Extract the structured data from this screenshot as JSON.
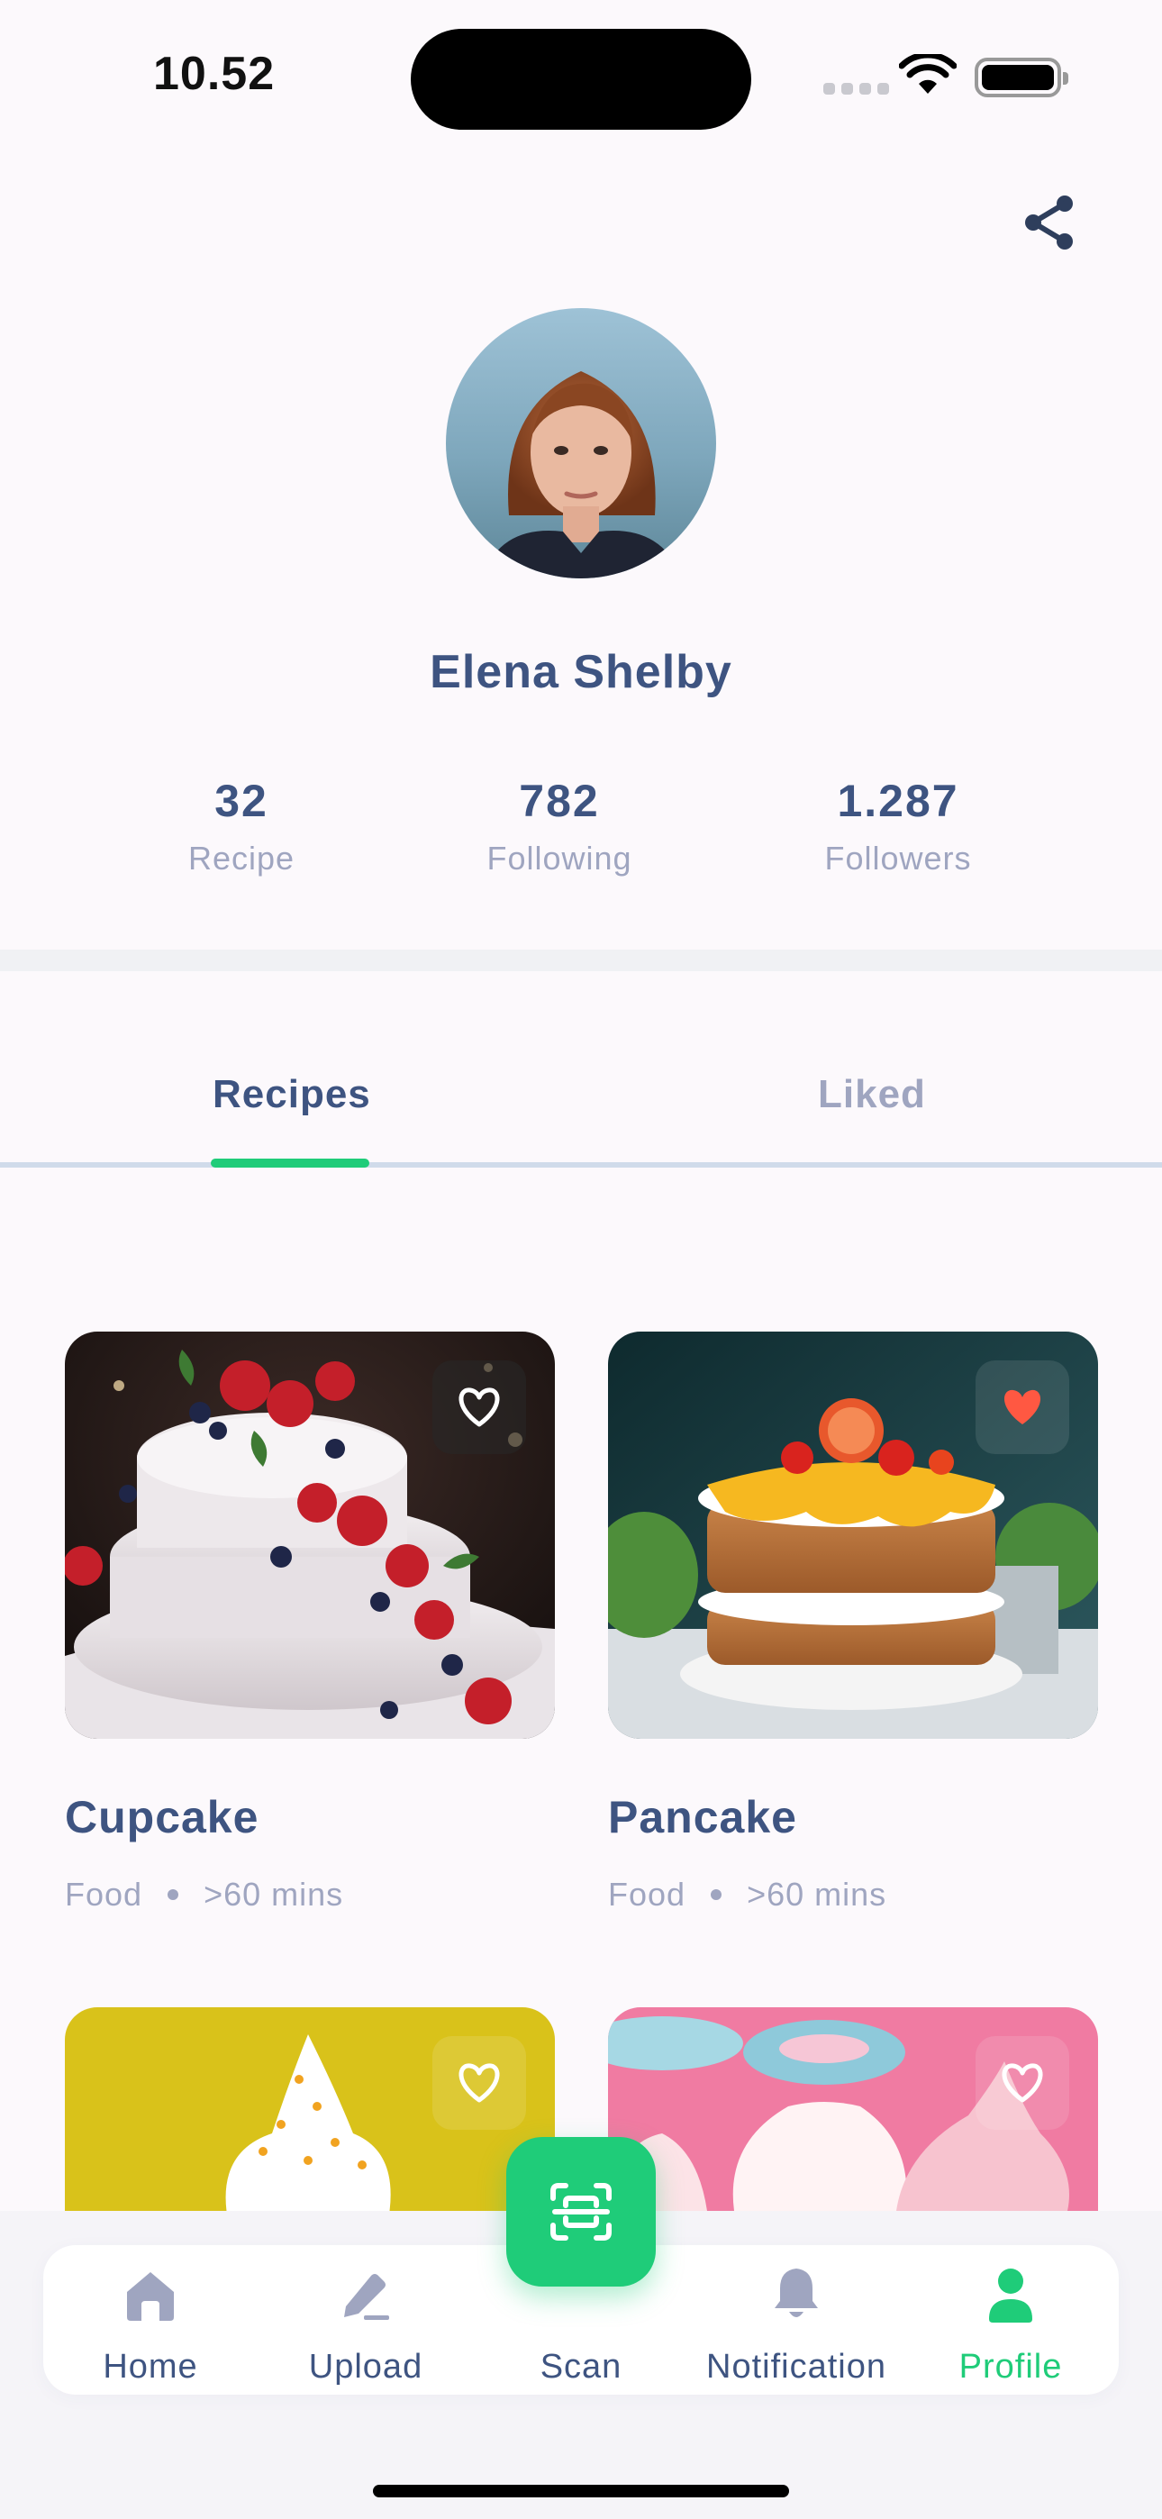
{
  "status_bar": {
    "time": "10.52"
  },
  "profile": {
    "name": "Elena Shelby",
    "stats": [
      {
        "value": "32",
        "label": "Recipe"
      },
      {
        "value": "782",
        "label": "Following"
      },
      {
        "value": "1.287",
        "label": "Followers"
      }
    ]
  },
  "tabs": [
    {
      "label": "Recipes",
      "active": true
    },
    {
      "label": "Liked",
      "active": false
    }
  ],
  "recipes": [
    {
      "title": "Cupcake",
      "category": "Food",
      "duration": ">60 mins",
      "liked": false
    },
    {
      "title": "Pancake",
      "category": "Food",
      "duration": ">60 mins",
      "liked": true
    },
    {
      "title": "",
      "category": "",
      "duration": "",
      "liked": false
    },
    {
      "title": "",
      "category": "",
      "duration": "",
      "liked": false
    }
  ],
  "nav": {
    "items": [
      {
        "label": "Home",
        "icon": "home-icon"
      },
      {
        "label": "Upload",
        "icon": "pencil-icon"
      },
      {
        "label": "Scan",
        "icon": "scan-icon"
      },
      {
        "label": "Notification",
        "icon": "bell-icon"
      },
      {
        "label": "Profile",
        "icon": "user-icon",
        "active": true
      }
    ]
  },
  "colors": {
    "primary": "#1FCC79",
    "title": "#3E5481",
    "muted": "#9FA5C0",
    "heart_active": "#FF5842"
  }
}
